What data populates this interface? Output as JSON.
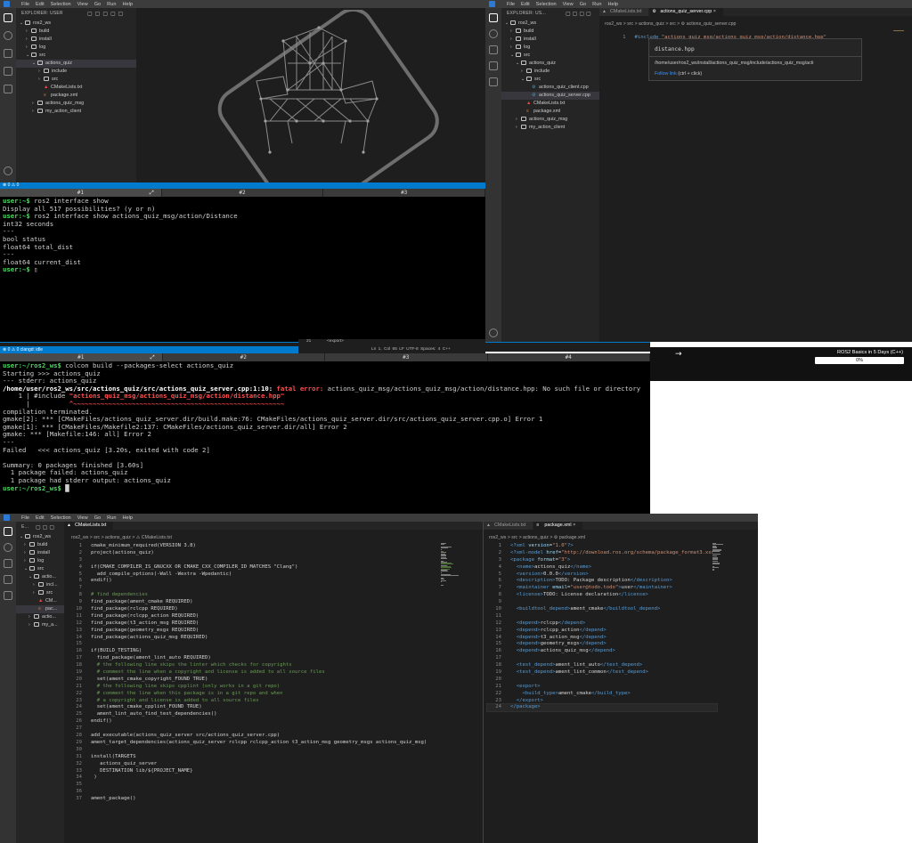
{
  "menu": [
    "File",
    "Edit",
    "Selection",
    "View",
    "Go",
    "Run",
    "Help"
  ],
  "top_left": {
    "explorer_header": "EXPLORER: USER",
    "tree": [
      {
        "label": "ros2_ws",
        "level": 0,
        "kind": "open"
      },
      {
        "label": "build",
        "level": 1,
        "kind": "closed"
      },
      {
        "label": "install",
        "level": 1,
        "kind": "closed"
      },
      {
        "label": "log",
        "level": 1,
        "kind": "closed"
      },
      {
        "label": "src",
        "level": 1,
        "kind": "open"
      },
      {
        "label": "actions_quiz",
        "level": 2,
        "kind": "open",
        "selected": true
      },
      {
        "label": "include",
        "level": 3,
        "kind": "closed"
      },
      {
        "label": "src",
        "level": 3,
        "kind": "closed"
      },
      {
        "label": "CMakeLists.txt",
        "level": 3,
        "kind": "cmake"
      },
      {
        "label": "package.xml",
        "level": 3,
        "kind": "xml"
      },
      {
        "label": "actions_quiz_msg",
        "level": 2,
        "kind": "closed"
      },
      {
        "label": "my_action_client",
        "level": 2,
        "kind": "closed"
      }
    ],
    "status": "⊗ 0 ⚠ 0"
  },
  "term1": {
    "tabs": [
      "#1",
      "#2",
      "#3"
    ],
    "lines": [
      [
        {
          "t": "user:~$ ",
          "c": "grn"
        },
        {
          "t": "ros2 interface show",
          "c": ""
        }
      ],
      [
        {
          "t": "Display all 517 possibilities? (y or n)",
          "c": ""
        }
      ],
      [
        {
          "t": "user:~$ ",
          "c": "grn"
        },
        {
          "t": "ros2 interface show actions_quiz_msg/action/Distance",
          "c": ""
        }
      ],
      [
        {
          "t": "int32 seconds",
          "c": ""
        }
      ],
      [
        {
          "t": "---",
          "c": ""
        }
      ],
      [
        {
          "t": "bool status",
          "c": ""
        }
      ],
      [
        {
          "t": "float64 total_dist",
          "c": ""
        }
      ],
      [
        {
          "t": "---",
          "c": ""
        }
      ],
      [
        {
          "t": "float64 current_dist",
          "c": ""
        }
      ],
      [
        {
          "t": "user:~$ ",
          "c": "grn"
        },
        {
          "t": "▯",
          "c": ""
        }
      ]
    ]
  },
  "top_right": {
    "explorer_header": "EXPLORER: US...",
    "tabs": [
      {
        "label": "CMakeLists.txt",
        "active": false
      },
      {
        "label": "actions_quiz_server.cpp",
        "active": true
      }
    ],
    "crumbs": "ros2_ws > src > actions_quiz > src > ⚙ actions_quiz_server.cpp",
    "tree": [
      {
        "label": "ros2_ws",
        "level": 0,
        "kind": "open"
      },
      {
        "label": "build",
        "level": 1,
        "kind": "closed"
      },
      {
        "label": "install",
        "level": 1,
        "kind": "closed"
      },
      {
        "label": "log",
        "level": 1,
        "kind": "closed"
      },
      {
        "label": "src",
        "level": 1,
        "kind": "open"
      },
      {
        "label": "actions_quiz",
        "level": 2,
        "kind": "open"
      },
      {
        "label": "include",
        "level": 3,
        "kind": "closed"
      },
      {
        "label": "src",
        "level": 3,
        "kind": "open"
      },
      {
        "label": "actions_quiz_client.cpp",
        "level": 4,
        "kind": "cpp"
      },
      {
        "label": "actions_quiz_server.cpp",
        "level": 4,
        "kind": "cpp",
        "selected": true
      },
      {
        "label": "CMakeLists.txt",
        "level": 3,
        "kind": "cmake"
      },
      {
        "label": "package.xml",
        "level": 3,
        "kind": "xml"
      },
      {
        "label": "actions_quiz_msg",
        "level": 2,
        "kind": "closed"
      },
      {
        "label": "my_action_client",
        "level": 2,
        "kind": "closed"
      }
    ],
    "line_no": "1",
    "code_kw": "#include ",
    "code_str": "\"actions_quiz_msg/actions_quiz_msg/action/distance.hpp\"",
    "hover_title": "distance.hpp",
    "hover_path": "/home/user/ros2_ws/install/actions_quiz_msg/include/actions_quiz_msg/acti",
    "hover_link": "Follow link",
    "hover_hint": " (ctrl + click)",
    "status_pos": "21",
    "status_exp": "<export>",
    "status_right": [
      "Ln 1, Col 65",
      "LF",
      "UTF-8",
      "Spaces: 4",
      "C++"
    ]
  },
  "status_mid_left": "⊗ 0 ⚠ 0    clangd: idle",
  "banner": {
    "arrow": "→",
    "course": "ROS2 Basics in 5 Days (C++)",
    "progress_label": "0%",
    "progress": 0
  },
  "term2": {
    "tabs": [
      "#1",
      "#2",
      "#3",
      "#4"
    ],
    "lines": [
      [
        {
          "t": "user:~/ros2_ws$ ",
          "c": "grn"
        },
        {
          "t": "colcon build --packages-select actions_quiz",
          "c": ""
        }
      ],
      [
        {
          "t": "Starting >>> actions_quiz",
          "c": ""
        }
      ],
      [
        {
          "t": "--- stderr: actions_quiz",
          "c": ""
        }
      ],
      [
        {
          "t": "/home/user/ros2_ws/src/actions_quiz/src/actions_quiz_server.cpp:1:10: ",
          "c": "wht"
        },
        {
          "t": "fatal error: ",
          "c": "red"
        },
        {
          "t": "actions_quiz_msg/actions_quiz_msg/action/distance.hpp: No such file or directory",
          "c": ""
        }
      ],
      [
        {
          "t": "    1 | #include ",
          "c": ""
        },
        {
          "t": "\"actions_quiz_msg/actions_quiz_msg/action/distance.hpp\"",
          "c": "red"
        }
      ],
      [
        {
          "t": "      |          ",
          "c": ""
        },
        {
          "t": "^~~~~~~~~~~~~~~~~~~~~~~~~~~~~~~~~~~~~~~~~~~~~~~~~~~~~~~",
          "c": "red"
        }
      ],
      [
        {
          "t": "compilation terminated.",
          "c": ""
        }
      ],
      [
        {
          "t": "gmake[2]: *** [CMakeFiles/actions_quiz_server.dir/build.make:76: CMakeFiles/actions_quiz_server.dir/src/actions_quiz_server.cpp.o] Error 1",
          "c": ""
        }
      ],
      [
        {
          "t": "gmake[1]: *** [CMakeFiles/Makefile2:137: CMakeFiles/actions_quiz_server.dir/all] Error 2",
          "c": ""
        }
      ],
      [
        {
          "t": "gmake: *** [Makefile:146: all] Error 2",
          "c": ""
        }
      ],
      [
        {
          "t": "---",
          "c": ""
        }
      ],
      [
        {
          "t": "Failed   <<< actions_quiz [3.20s, exited with code 2]",
          "c": ""
        }
      ],
      [
        {
          "t": "",
          "c": ""
        }
      ],
      [
        {
          "t": "Summary: 0 packages finished [3.60s]",
          "c": ""
        }
      ],
      [
        {
          "t": "  1 package failed: actions_quiz",
          "c": ""
        }
      ],
      [
        {
          "t": "  1 package had stderr output: actions_quiz",
          "c": ""
        }
      ],
      [
        {
          "t": "user:~/ros2_ws$ ",
          "c": "grn"
        },
        {
          "t": "█",
          "c": ""
        }
      ]
    ]
  },
  "bottom": {
    "explorer_header": "E...",
    "tree": [
      {
        "label": "ros2_ws",
        "level": 0,
        "kind": "open"
      },
      {
        "label": "build",
        "level": 1,
        "kind": "closed"
      },
      {
        "label": "install",
        "level": 1,
        "kind": "closed"
      },
      {
        "label": "log",
        "level": 1,
        "kind": "closed"
      },
      {
        "label": "src",
        "level": 1,
        "kind": "open"
      },
      {
        "label": "actio...",
        "level": 2,
        "kind": "open"
      },
      {
        "label": "incl...",
        "level": 3,
        "kind": "closed"
      },
      {
        "label": "src",
        "level": 3,
        "kind": "closed"
      },
      {
        "label": "CM...",
        "level": 3,
        "kind": "cmake"
      },
      {
        "label": "pac...",
        "level": 3,
        "kind": "xml",
        "selected": true
      },
      {
        "label": "actio...",
        "level": 2,
        "kind": "closed"
      },
      {
        "label": "my_a...",
        "level": 2,
        "kind": "closed"
      }
    ],
    "left_tab": "CMakeLists.txt",
    "left_crumbs": "ros2_ws > src > actions_quiz > ⚠ CMakeLists.txt",
    "right_tabs": [
      {
        "label": "CMakeLists.txt",
        "active": false
      },
      {
        "label": "package.xml",
        "active": true
      }
    ],
    "right_crumbs": "ros2_ws > src > actions_quiz > ⚙ package.xml",
    "cmake_lines": [
      [
        {
          "t": "cmake_minimum_required(VERSION 3.8)",
          "c": ""
        }
      ],
      [
        {
          "t": "project(actions_quiz)",
          "c": ""
        }
      ],
      [],
      [
        {
          "t": "if(CMAKE_COMPILER_IS_GNUCXX OR CMAKE_CXX_COMPILER_ID MATCHES \"Clang\")",
          "c": ""
        }
      ],
      [
        {
          "t": "  add_compile_options(-Wall -Wextra -Wpedantic)",
          "c": ""
        }
      ],
      [
        {
          "t": "endif()",
          "c": ""
        }
      ],
      [],
      [
        {
          "t": "# find dependencies",
          "c": "cmt"
        }
      ],
      [
        {
          "t": "find_package(ament_cmake REQUIRED)",
          "c": ""
        }
      ],
      [
        {
          "t": "find_package(rclcpp REQUIRED)",
          "c": ""
        }
      ],
      [
        {
          "t": "find_package(rclcpp_action REQUIRED)",
          "c": ""
        }
      ],
      [
        {
          "t": "find_package(t3_action_msg REQUIRED)",
          "c": ""
        }
      ],
      [
        {
          "t": "find_package(geometry_msgs REQUIRED)",
          "c": ""
        }
      ],
      [
        {
          "t": "find_package(actions_quiz_msg REQUIRED)",
          "c": ""
        }
      ],
      [],
      [
        {
          "t": "if(BUILD_TESTING)",
          "c": ""
        }
      ],
      [
        {
          "t": "  find_package(ament_lint_auto REQUIRED)",
          "c": ""
        }
      ],
      [
        {
          "t": "  # the following line skips the linter which checks for copyrights",
          "c": "cmt"
        }
      ],
      [
        {
          "t": "  # comment the line when a copyright and license is added to all source files",
          "c": "cmt"
        }
      ],
      [
        {
          "t": "  set(ament_cmake_copyright_FOUND TRUE)",
          "c": ""
        }
      ],
      [
        {
          "t": "  # the following line skips cpplint (only works in a git repo)",
          "c": "cmt"
        }
      ],
      [
        {
          "t": "  # comment the line when this package is in a git repo and when",
          "c": "cmt"
        }
      ],
      [
        {
          "t": "  # a copyright and license is added to all source files",
          "c": "cmt"
        }
      ],
      [
        {
          "t": "  set(ament_cmake_cpplint_FOUND TRUE)",
          "c": ""
        }
      ],
      [
        {
          "t": "  ament_lint_auto_find_test_dependencies()",
          "c": ""
        }
      ],
      [
        {
          "t": "endif()",
          "c": ""
        }
      ],
      [],
      [
        {
          "t": "add_executable(actions_quiz_server src/actions_quiz_server.cpp)",
          "c": ""
        }
      ],
      [
        {
          "t": "ament_target_dependencies(actions_quiz_server rclcpp rclcpp_action t3_action_msg geometry_msgs actions_quiz_msg)",
          "c": ""
        }
      ],
      [],
      [
        {
          "t": "install(TARGETS",
          "c": ""
        }
      ],
      [
        {
          "t": "   actions_quiz_server",
          "c": ""
        }
      ],
      [
        {
          "t": "   DESTINATION lib/${PROJECT_NAME}",
          "c": ""
        }
      ],
      [
        {
          "t": " )",
          "c": ""
        }
      ],
      [],
      [],
      [
        {
          "t": "ament_package()",
          "c": ""
        }
      ]
    ],
    "xml_lines": [
      [
        {
          "t": "<?xml ",
          "c": "tag"
        },
        {
          "t": "version",
          "c": "attr"
        },
        {
          "t": "=",
          "c": ""
        },
        {
          "t": "\"1.0\"",
          "c": "str"
        },
        {
          "t": "?>",
          "c": "tag"
        }
      ],
      [
        {
          "t": "<?xml-model ",
          "c": "tag"
        },
        {
          "t": "href",
          "c": "attr"
        },
        {
          "t": "=",
          "c": ""
        },
        {
          "t": "\"http://download.ros.org/schema/package_format3.xsd\"",
          "c": "str"
        }
      ],
      [
        {
          "t": "<package ",
          "c": "tag"
        },
        {
          "t": "format",
          "c": "attr"
        },
        {
          "t": "=",
          "c": ""
        },
        {
          "t": "\"3\"",
          "c": "str"
        },
        {
          "t": ">",
          "c": "tag"
        }
      ],
      [
        {
          "t": "  <name>",
          "c": "tag"
        },
        {
          "t": "actions_quiz",
          "c": ""
        },
        {
          "t": "</name>",
          "c": "tag"
        }
      ],
      [
        {
          "t": "  <version>",
          "c": "tag"
        },
        {
          "t": "0.0.0",
          "c": ""
        },
        {
          "t": "</version>",
          "c": "tag"
        }
      ],
      [
        {
          "t": "  <description>",
          "c": "tag"
        },
        {
          "t": "TODO: Package description",
          "c": ""
        },
        {
          "t": "</description>",
          "c": "tag"
        }
      ],
      [
        {
          "t": "  <maintainer ",
          "c": "tag"
        },
        {
          "t": "email",
          "c": "attr"
        },
        {
          "t": "=",
          "c": ""
        },
        {
          "t": "\"user@todo.todo\"",
          "c": "str"
        },
        {
          "t": ">",
          "c": "tag"
        },
        {
          "t": "user",
          "c": ""
        },
        {
          "t": "</maintainer>",
          "c": "tag"
        }
      ],
      [
        {
          "t": "  <license>",
          "c": "tag"
        },
        {
          "t": "TODO: License declaration",
          "c": ""
        },
        {
          "t": "</license>",
          "c": "tag"
        }
      ],
      [],
      [
        {
          "t": "  <buildtool_depend>",
          "c": "tag"
        },
        {
          "t": "ament_cmake",
          "c": ""
        },
        {
          "t": "</buildtool_depend>",
          "c": "tag"
        }
      ],
      [],
      [
        {
          "t": "  <depend>",
          "c": "tag"
        },
        {
          "t": "rclcpp",
          "c": ""
        },
        {
          "t": "</depend>",
          "c": "tag"
        }
      ],
      [
        {
          "t": "  <depend>",
          "c": "tag"
        },
        {
          "t": "rclcpp_action",
          "c": ""
        },
        {
          "t": "</depend>",
          "c": "tag"
        }
      ],
      [
        {
          "t": "  <depend>",
          "c": "tag"
        },
        {
          "t": "t3_action_msg",
          "c": ""
        },
        {
          "t": "</depend>",
          "c": "tag"
        }
      ],
      [
        {
          "t": "  <depend>",
          "c": "tag"
        },
        {
          "t": "geometry_msgs",
          "c": ""
        },
        {
          "t": "</depend>",
          "c": "tag"
        }
      ],
      [
        {
          "t": "  <depend>",
          "c": "tag"
        },
        {
          "t": "actions_quiz_msg",
          "c": ""
        },
        {
          "t": "</depend>",
          "c": "tag"
        }
      ],
      [],
      [
        {
          "t": "  <test_depend>",
          "c": "tag"
        },
        {
          "t": "ament_lint_auto",
          "c": ""
        },
        {
          "t": "</test_depend>",
          "c": "tag"
        }
      ],
      [
        {
          "t": "  <test_depend>",
          "c": "tag"
        },
        {
          "t": "ament_lint_common",
          "c": ""
        },
        {
          "t": "</test_depend>",
          "c": "tag"
        }
      ],
      [],
      [
        {
          "t": "  <export>",
          "c": "tag"
        }
      ],
      [
        {
          "t": "    <build_type>",
          "c": "tag"
        },
        {
          "t": "ament_cmake",
          "c": ""
        },
        {
          "t": "</build_type>",
          "c": "tag"
        }
      ],
      [
        {
          "t": "  </export>",
          "c": "tag"
        }
      ],
      [
        {
          "t": "</package>",
          "c": "tag"
        }
      ]
    ]
  }
}
